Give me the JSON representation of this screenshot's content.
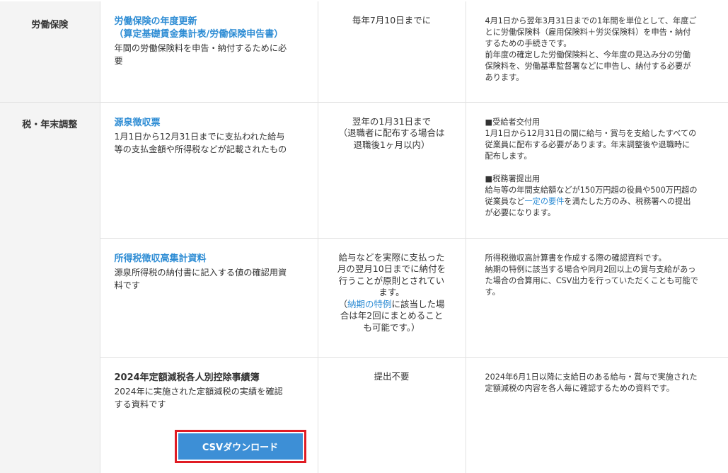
{
  "rows": [
    {
      "category": "労働保険",
      "title_lines": [
        "労働保険の年度更新",
        "（算定基礎賃金集計表/労働保険申告書）"
      ],
      "desc_lines": [
        "年間の労働保険料を申告・納付するために必",
        "要"
      ],
      "deadline_lines": [
        "毎年7月10日までに"
      ],
      "note_lines": [
        "4月1日から翌年3月31日までの1年間を単位として、年度ご",
        "とに労働保険料（雇用保険料＋労災保険料）を申告・納付",
        "するための手続きです。",
        "前年度の確定した労働保険料と、今年度の見込み分の労働",
        "保険料を、労働基準監督署などに申告し、納付する必要が",
        "あります。"
      ]
    },
    {
      "category": "税・年末調整",
      "title_lines": [
        "源泉徴収票"
      ],
      "desc_lines": [
        "1月1日から12月31日までに支払われた給与",
        "等の支払金額や所得税などが記載されたもの"
      ],
      "deadline_lines": [
        "翌年の1月31日まで",
        "（退職者に配布する場合は",
        "退職後1ヶ月以内）"
      ],
      "note_a_lines": [
        "■受給者交付用",
        "1月1日から12月31日の間に給与・賞与を支給したすべての",
        "従業員に配布する必要があります。年末調整後や退職時に",
        "配布します。"
      ],
      "note_b_lines": [
        "■税務署提出用",
        "給与等の年間支給額などが150万円超の役員や500万円超の"
      ],
      "note_b3_pre": "従業員など",
      "note_b3_link": "一定の要件",
      "note_b3_post": "を満たした方のみ、税務署への提出",
      "note_b4": "が必要になります。"
    },
    {
      "title_lines": [
        "所得税徴収高集計資料"
      ],
      "desc_lines": [
        "源泉所得税の納付書に記入する値の確認用資",
        "料です"
      ],
      "deadline_lines": [
        "給与などを実際に支払った",
        "月の翌月10日までに納付を",
        "行うことが原則とされてい",
        "ます。"
      ],
      "deadline_pre": "（",
      "deadline_link": "納期の特例",
      "deadline_post": "に該当した場",
      "deadline_tail": [
        "合は年2回にまとめること",
        "も可能です。）"
      ],
      "note_lines": [
        "所得税徴収高計算書を作成する際の確認資料です。",
        "納期の特例に該当する場合や同月2回以上の賞与支給があっ",
        "た場合の合算用に、CSV出力を行っていただくことも可能で",
        "す。"
      ]
    },
    {
      "title_lines": [
        "2024年定額減税各人別控除事績簿"
      ],
      "desc_lines": [
        "2024年に実施された定額減税の実績を確認",
        "する資料です"
      ],
      "deadline_lines": [
        "提出不要"
      ],
      "note_lines": [
        "2024年6月1日以降に支給日のある給与・賞与で実施された",
        "定額減税の内容を各人毎に確認するための資料です。"
      ],
      "button_label": "CSVダウンロード"
    }
  ]
}
